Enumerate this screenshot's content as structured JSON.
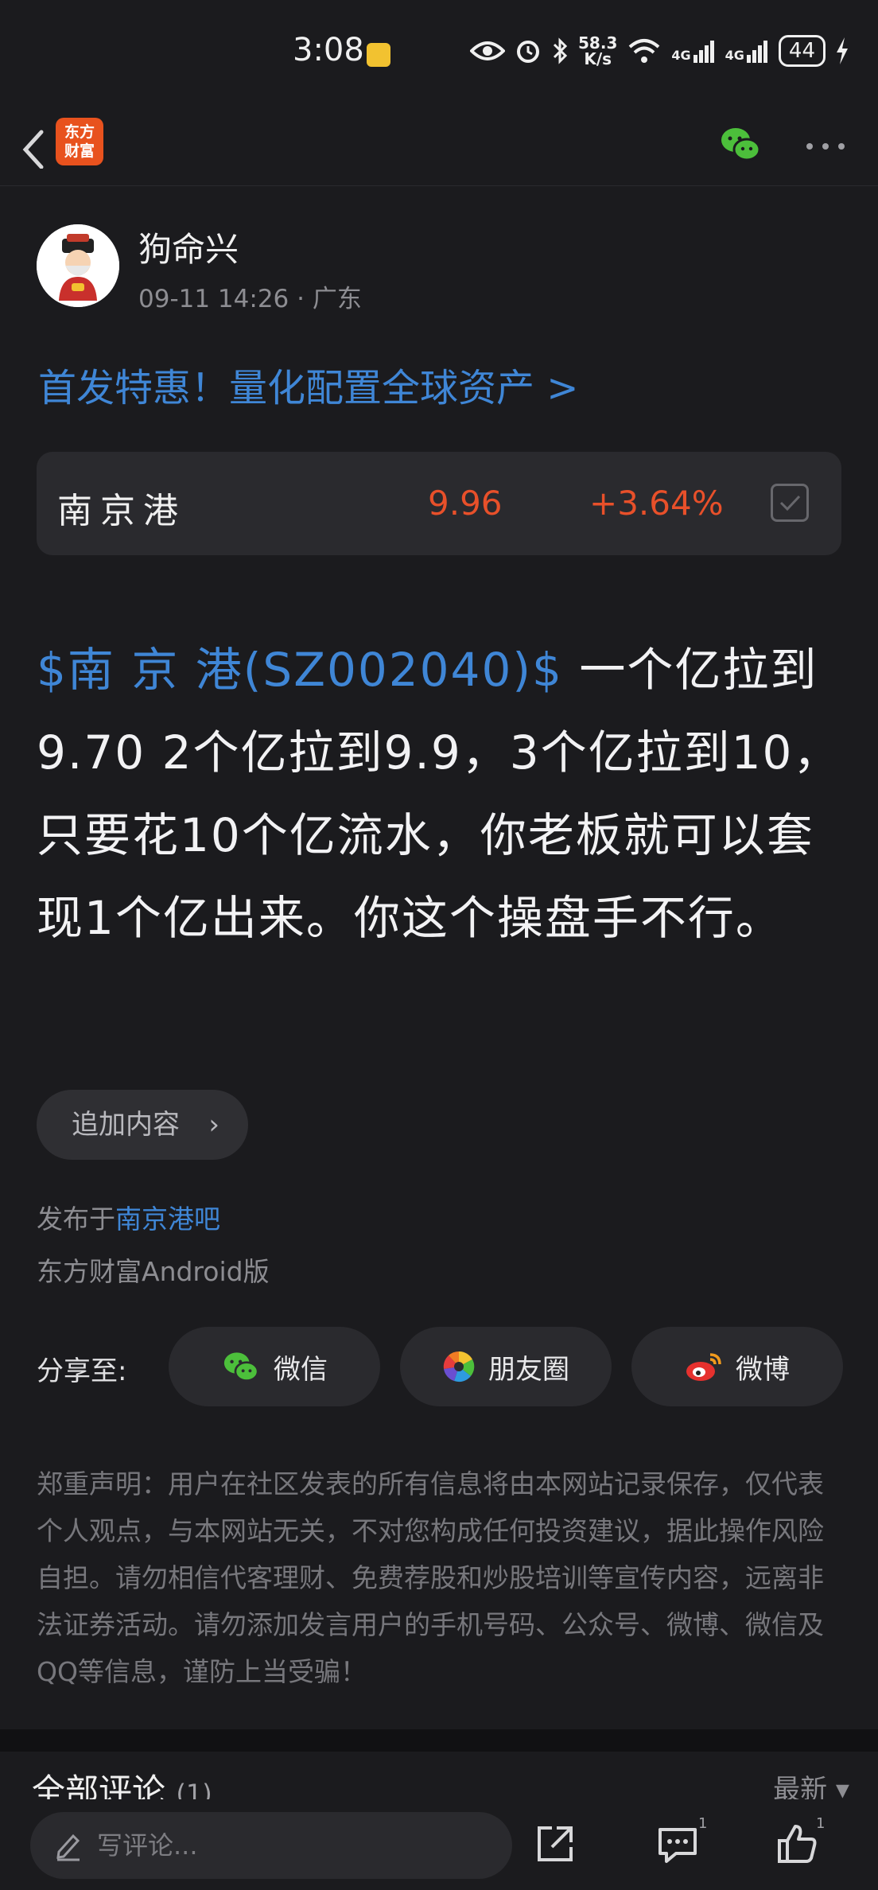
{
  "status_bar": {
    "time": "3:08",
    "speed_top": "58.3",
    "speed_bottom": "K/s",
    "net1": "4G",
    "net2": "4G",
    "battery": "44"
  },
  "nav": {
    "logo_line1": "东方",
    "logo_line2": "财富"
  },
  "post": {
    "author": "狗命兴",
    "meta": "09-11 14:26 · 广东",
    "promo": "首发特惠！量化配置全球资产 >",
    "stock": {
      "name": "南京港",
      "price": "9.96",
      "change": "+3.64%"
    },
    "content_link": "$南 京 港(SZ002040)$",
    "content_text": " 一个亿拉到9.70 2个亿拉到9.9，3个亿拉到10，只要花10个亿流水，你老板就可以套现1个亿出来。你这个操盘手不行。",
    "append_label": "追加内容",
    "published_prefix": "发布于",
    "published_bar": "南京港吧",
    "client": "东方财富Android版"
  },
  "share": {
    "label": "分享至:",
    "wechat": "微信",
    "moments": "朋友圈",
    "weibo": "微博"
  },
  "disclaimer": "郑重声明：用户在社区发表的所有信息将由本网站记录保存，仅代表个人观点，与本网站无关，不对您构成任何投资建议，据此操作风险自担。请勿相信代客理财、免费荐股和炒股培训等宣传内容，远离非法证券活动。请勿添加发言用户的手机号码、公众号、微博、微信及QQ等信息，谨防上当受骗！",
  "comments": {
    "title": "全部评论",
    "count": "(1)",
    "sort": "最新 ▾"
  },
  "bottom_bar": {
    "placeholder": "写评论...",
    "comment_count": "1",
    "like_count": "1"
  },
  "colors": {
    "link": "#3f86d6",
    "up": "#e8502a",
    "background": "#1b1b1e"
  }
}
